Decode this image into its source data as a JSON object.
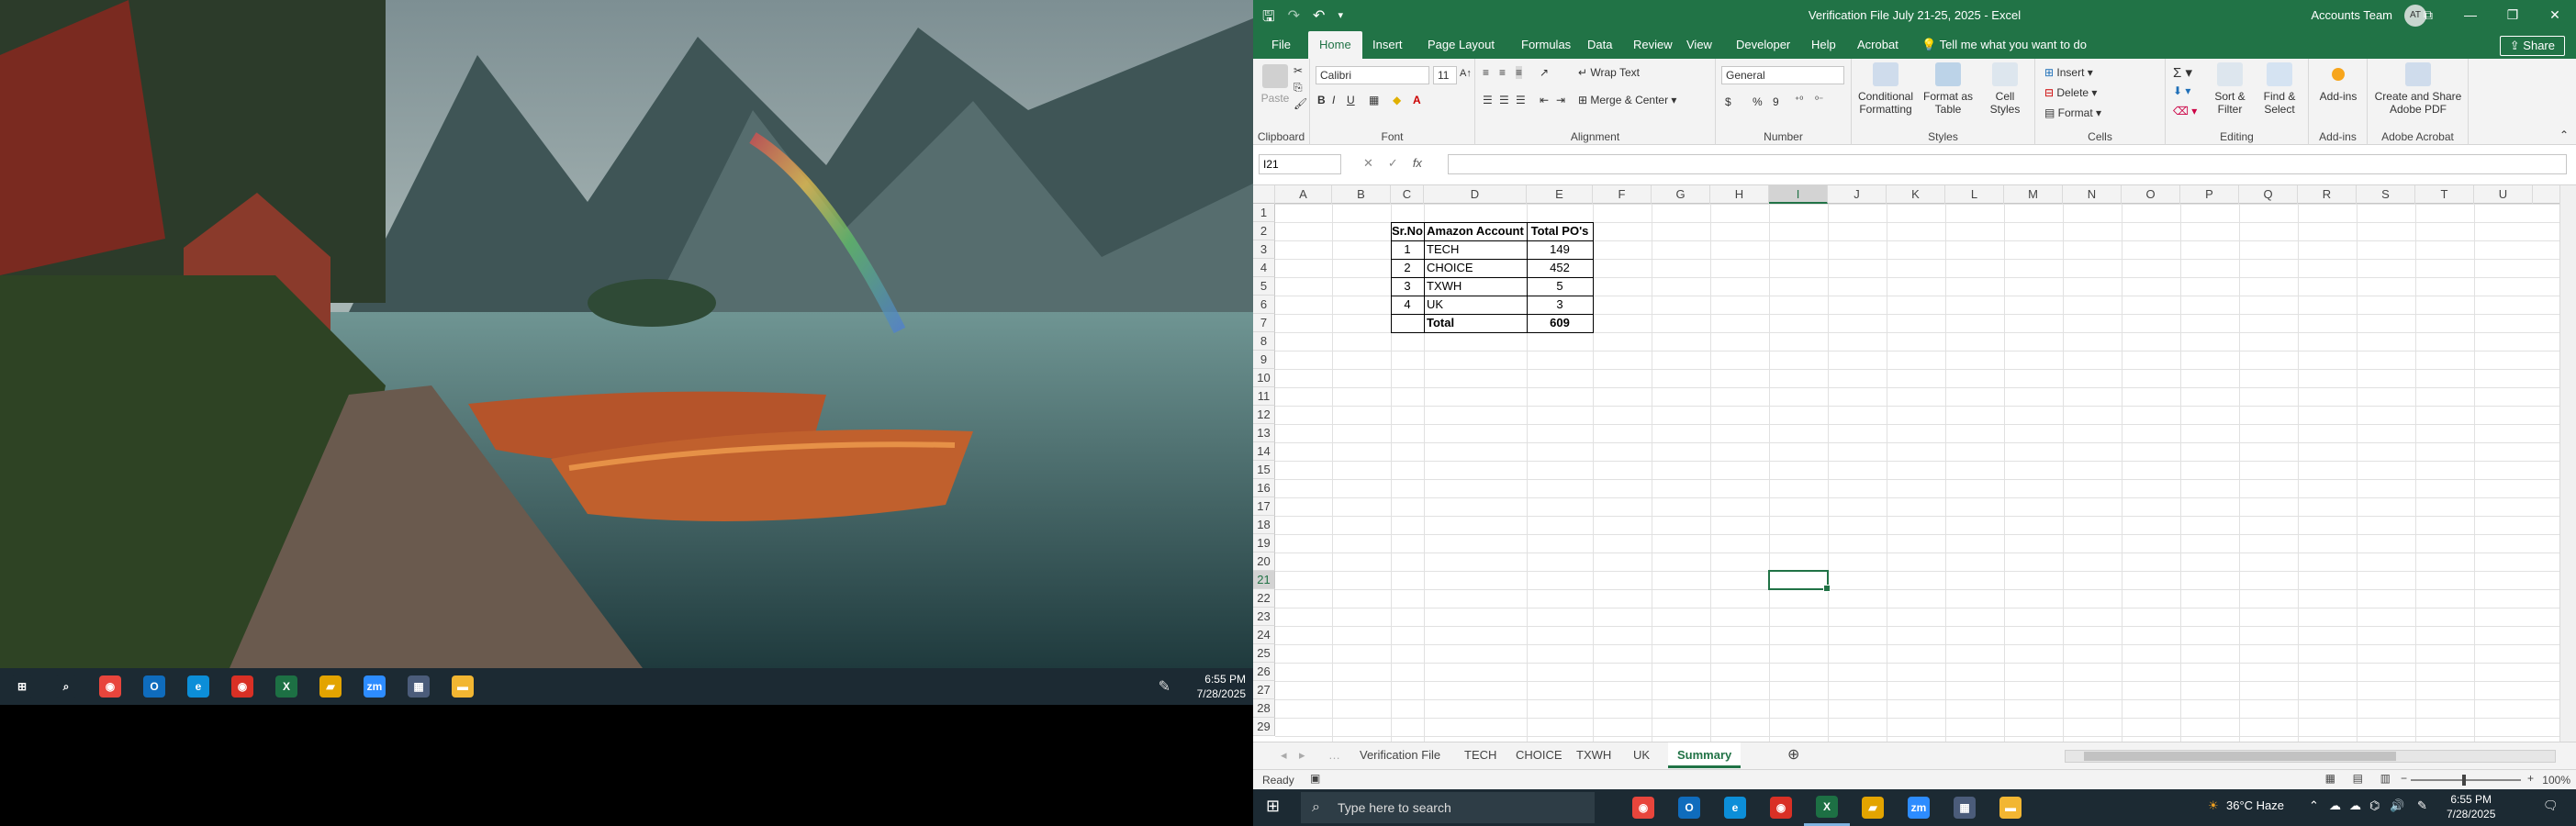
{
  "left_taskbar": {
    "time": "6:55 PM",
    "date": "7/28/2025",
    "apps": [
      {
        "name": "start-icon",
        "color": "#1c2a33",
        "glyph": "⊞"
      },
      {
        "name": "search-icon",
        "color": "#1c2a33",
        "glyph": "⌕"
      },
      {
        "name": "chrome-icon",
        "color": "#e8453c",
        "glyph": "◉"
      },
      {
        "name": "outlook-icon",
        "color": "#0f6cbd",
        "glyph": "O"
      },
      {
        "name": "edge-icon",
        "color": "#0c8ed8",
        "glyph": "e"
      },
      {
        "name": "chrome-profile-icon",
        "color": "#d93025",
        "glyph": "◉"
      },
      {
        "name": "excel-icon",
        "color": "#1d7044",
        "glyph": "X"
      },
      {
        "name": "sticky-notes-icon",
        "color": "#e3a400",
        "glyph": "▰"
      },
      {
        "name": "zoom-icon",
        "color": "#2d8cff",
        "glyph": "zm"
      },
      {
        "name": "calculator-icon",
        "color": "#4b5c7a",
        "glyph": "▦"
      },
      {
        "name": "file-explorer-icon",
        "color": "#f2b632",
        "glyph": "▬"
      }
    ]
  },
  "excel": {
    "title": "Verification File July 21-25, 2025  -  Excel",
    "account": "Accounts Team",
    "avatar": "AT",
    "tabs": [
      "File",
      "Home",
      "Insert",
      "Page Layout",
      "Formulas",
      "Data",
      "Review",
      "View",
      "Developer",
      "Help",
      "Acrobat"
    ],
    "active_tab": "Home",
    "tell_me": "Tell me what you want to do",
    "share": "Share",
    "ribbon": {
      "paste": "Paste",
      "clipboard": "Clipboard",
      "font_name": "Calibri",
      "font_size": "11",
      "font": "Font",
      "wrap_text": "Wrap Text",
      "merge_center": "Merge & Center",
      "alignment": "Alignment",
      "number_format": "General",
      "number": "Number",
      "currency": "$",
      "percent": "%",
      "comma": "9",
      "cond_formatting": "Conditional Formatting",
      "format_as_table": "Format as Table",
      "cell_styles": "Cell Styles",
      "styles": "Styles",
      "insert": "Insert",
      "delete": "Delete",
      "format": "Format",
      "cells": "Cells",
      "sort_filter": "Sort & Filter",
      "find_select": "Find & Select",
      "editing": "Editing",
      "addins": "Add-ins",
      "addins_group": "Add-ins",
      "create_share": "Create and Share Adobe PDF",
      "adobe_acrobat": "Adobe Acrobat"
    },
    "name_box": "I21",
    "fx": "fx",
    "columns": [
      "A",
      "B",
      "C",
      "D",
      "E",
      "F",
      "G",
      "H",
      "I",
      "J",
      "K",
      "L",
      "M",
      "N",
      "O",
      "P",
      "Q",
      "R",
      "S",
      "T",
      "U"
    ],
    "selected_column": "I",
    "rows": [
      "1",
      "2",
      "3",
      "4",
      "5",
      "6",
      "7",
      "8",
      "9",
      "10",
      "11",
      "12",
      "13",
      "14",
      "15",
      "16",
      "17",
      "18",
      "19",
      "20",
      "21",
      "22",
      "23",
      "24",
      "25",
      "26",
      "27",
      "28",
      "29"
    ],
    "selected_row": "21",
    "table": {
      "headers": [
        "Sr.No",
        "Amazon Account",
        "Total PO's"
      ],
      "rows": [
        [
          "1",
          "TECH",
          "149"
        ],
        [
          "2",
          "CHOICE",
          "452"
        ],
        [
          "3",
          "TXWH",
          "5"
        ],
        [
          "4",
          "UK",
          "3"
        ],
        [
          "",
          "Total",
          "609"
        ]
      ]
    },
    "sheets": [
      "Verification File",
      "TECH",
      "CHOICE",
      "TXWH",
      "UK",
      "Summary"
    ],
    "active_sheet": "Summary",
    "status": "Ready",
    "zoom": "100%"
  },
  "right_taskbar": {
    "search_placeholder": "Type here to search",
    "weather": "36°C  Haze",
    "time": "6:55 PM",
    "date": "7/28/2025"
  }
}
